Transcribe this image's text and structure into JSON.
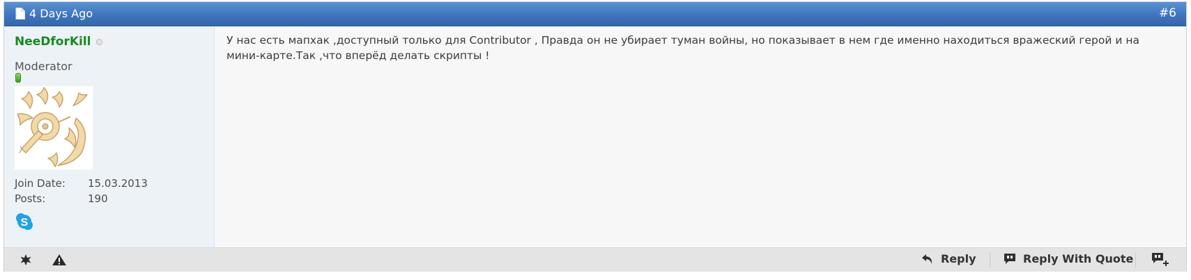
{
  "post": {
    "date": "4 Days Ago",
    "number": "#6",
    "user": {
      "name": "NeeDforKill",
      "status": "offline",
      "title": "Moderator",
      "join_label": "Join Date:",
      "join_value": "15.03.2013",
      "posts_label": "Posts:",
      "posts_value": "190"
    },
    "message": "У нас есть мапхак ,доступный только для Contributor , Правда он не убирает туман войны, но показывает в нем где именно находиться вражеский герой и на мини-карте.Так ,что вперёд делать скрипты !",
    "actions": {
      "reply": "Reply",
      "reply_quote": "Reply With Quote"
    }
  },
  "icons": {
    "header": "document-icon",
    "status": "offline-status-icon",
    "reputation": "reputation-icon",
    "contact": "skype-icon",
    "footer_left": [
      "star-icon",
      "warning-icon"
    ],
    "reply": "reply-arrow-icon",
    "reply_quote": "quote-bubble-icon",
    "multi_quote": "multi-quote-plus-icon"
  },
  "colors": {
    "header": "#3f75bd",
    "username": "#178a1f",
    "user_column": "#edf2f7",
    "footer": "#e4e4e4"
  }
}
